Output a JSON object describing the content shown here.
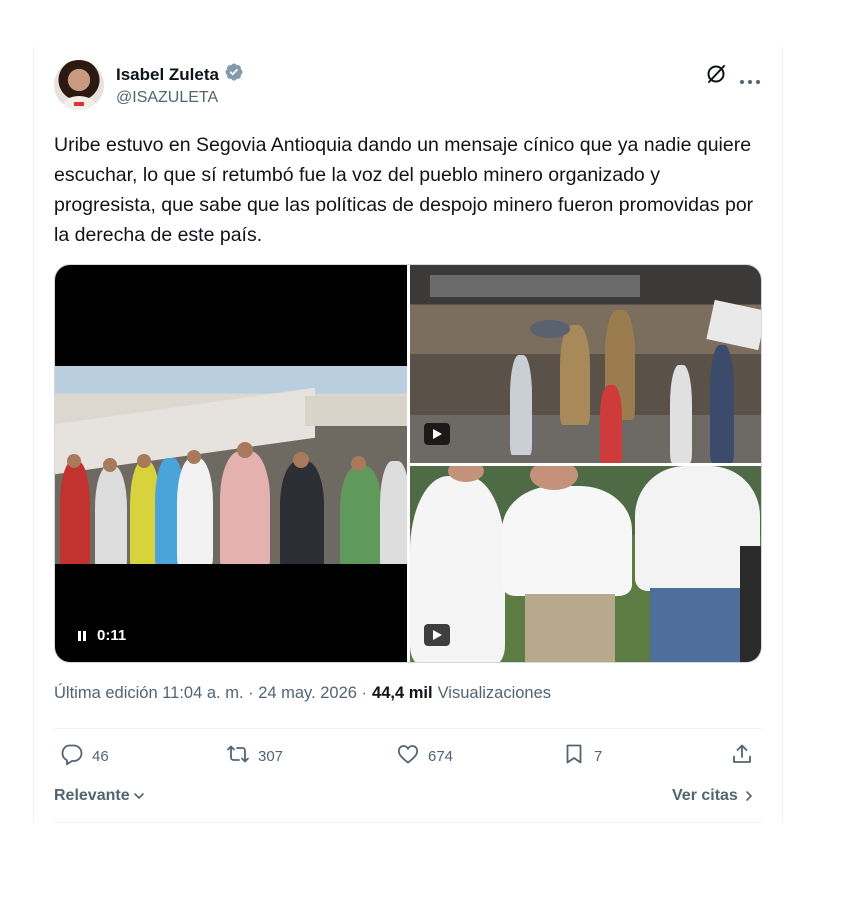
{
  "author": {
    "name": "Isabel Zuleta",
    "handle": "@ISAZULETA",
    "verified": true
  },
  "tweet": {
    "text": "Uribe estuvo en Segovia Antioquia dando un mensaje cínico que ya nadie quiere escuchar, lo que sí retumbó fue la voz del pueblo minero organizado y progresista, que sabe que las políticas de despojo minero fueron promovidas por la derecha de este país."
  },
  "media": {
    "video_time": "0:11",
    "video_state": "playing",
    "items": [
      {
        "type": "video",
        "description": "crowd with banner"
      },
      {
        "type": "video",
        "description": "crowd at statue plaza"
      },
      {
        "type": "video",
        "description": "men in white shirts"
      }
    ]
  },
  "meta": {
    "edited_prefix": "Última edición 11:04 a. m. · 24 may. 2026 ·",
    "views_count": "44,4 mil",
    "views_label": "Visualizaciones"
  },
  "actions": {
    "replies": "46",
    "retweets": "307",
    "likes": "674",
    "bookmarks": "7"
  },
  "footer": {
    "sort_label": "Relevante",
    "quotes_label": "Ver citas"
  },
  "colors": {
    "verified": "#829aab",
    "secondary_text": "#536471",
    "primary_text": "#0f1419",
    "divider": "#eff3f4"
  },
  "icons": [
    "verified-badge-icon",
    "grok-icon",
    "more-icon",
    "reply-icon",
    "retweet-icon",
    "like-icon",
    "bookmark-icon",
    "share-icon",
    "chevron-down-icon",
    "chevron-right-icon",
    "play-icon",
    "pause-icon"
  ]
}
